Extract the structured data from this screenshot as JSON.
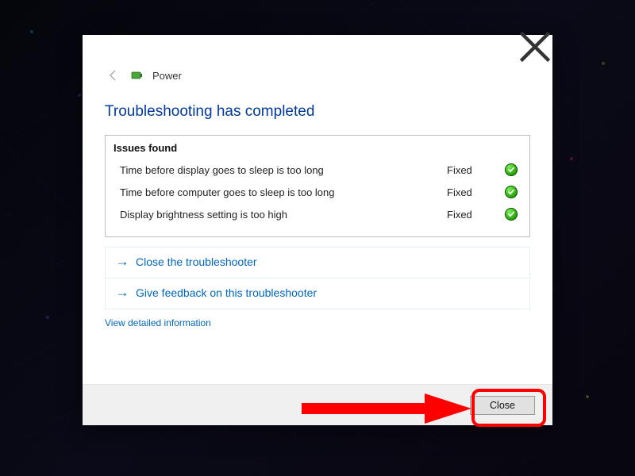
{
  "header": {
    "category_label": "Power"
  },
  "title": "Troubleshooting has completed",
  "issues": {
    "header": "Issues found",
    "rows": [
      {
        "desc": "Time before display goes to sleep is too long",
        "status": "Fixed"
      },
      {
        "desc": "Time before computer goes to sleep is too long",
        "status": "Fixed"
      },
      {
        "desc": "Display brightness setting is too high",
        "status": "Fixed"
      }
    ]
  },
  "options": {
    "close_troubleshooter": "Close the troubleshooter",
    "give_feedback": "Give feedback on this troubleshooter"
  },
  "detailed_link": "View detailed information",
  "footer": {
    "close_label": "Close"
  }
}
